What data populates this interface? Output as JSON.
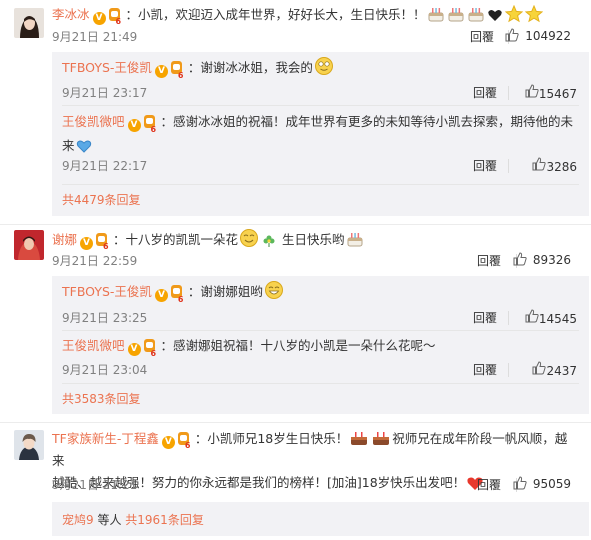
{
  "comments": [
    {
      "user": "李冰冰",
      "text": "：小凯，欢迎迈入成年世界，好好长大，生日快乐！！",
      "time": "9月21日 21:49",
      "reply_label": "回覆",
      "likes": "104922",
      "replies": [
        {
          "user": "TFBOYS-王俊凯",
          "text": "：谢谢冰冰姐，我会的",
          "time": "9月21日 23:17",
          "reply_label": "回覆",
          "likes": "15467"
        },
        {
          "user": "王俊凯微吧",
          "text_line1": "：感谢冰冰姐的祝福！成年世界有更多的未知等待小凯去探索，期待他的未",
          "text_line2": "来",
          "time": "9月21日 22:17",
          "reply_label": "回覆",
          "likes": "3286"
        }
      ],
      "more": "共4479条回复"
    },
    {
      "user": "谢娜",
      "text": "：十八岁的凯凯一朵花",
      "text_tail": "生日快乐哟",
      "time": "9月21日 22:59",
      "reply_label": "回覆",
      "likes": "89326",
      "replies": [
        {
          "user": "TFBOYS-王俊凯",
          "text": "：谢谢娜姐哟",
          "time": "9月21日 23:25",
          "reply_label": "回覆",
          "likes": "14545"
        },
        {
          "user": "王俊凯微吧",
          "text": "：感谢娜姐祝福！十八岁的小凯是一朵什么花呢～",
          "time": "9月21日 23:04",
          "reply_label": "回覆",
          "likes": "2437"
        }
      ],
      "more": "共3583条回复"
    },
    {
      "user": "TF家族新生-丁程鑫",
      "text": "：小凯师兄18岁生日快乐！",
      "text_mid": "祝师兄在成年阶段一帆风顺，越来",
      "text_line2": "越酷、越来越强！努力的你永远都是我们的榜样！[加油]18岁快乐出发吧！",
      "time": "9月21日 21:21",
      "reply_label": "回覆",
      "likes": "95059",
      "more_prefix": "宠鸠9",
      "more_mid": " 等人 ",
      "more": "共1961条回复"
    }
  ],
  "colors": {
    "username": "#eb7350",
    "reply_bg": "#f2f2f5",
    "meta": "#808080"
  }
}
